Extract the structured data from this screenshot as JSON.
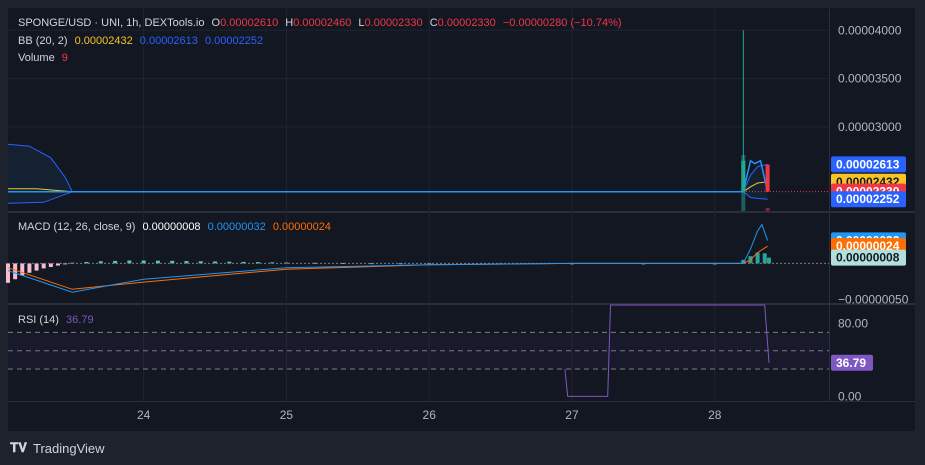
{
  "header": {
    "symbol": "SPONGE/USD · UNI, 1h, DEXTools.io",
    "o_label": "O",
    "o_value": "0.00002610",
    "h_label": "H",
    "h_value": "0.00002460",
    "l_label": "L",
    "l_value": "0.00002330",
    "c_label": "C",
    "c_value": "0.00002330",
    "change": "−0.00000280 (−10.74%)"
  },
  "bb_legend": {
    "label": "BB (20, 2)",
    "basis": "0.00002432",
    "upper": "0.00002613",
    "lower": "0.00002252"
  },
  "volume_legend": {
    "label": "Volume",
    "value": "9"
  },
  "macd_legend": {
    "label": "MACD (12, 26, close, 9)",
    "hist": "0.00000008",
    "macd": "0.00000032",
    "signal": "0.00000024"
  },
  "rsi_legend": {
    "label": "RSI (14)",
    "value": "36.79"
  },
  "price_axis": {
    "ticks": [
      "0.00004000",
      "0.00003500",
      "0.00003000"
    ],
    "tick_values": [
      4e-05,
      3.5e-05,
      3e-05
    ],
    "labels": [
      {
        "text": "0.00002613",
        "value": 2.613e-05,
        "color": "#2962ff",
        "text_color": "#ffffff"
      },
      {
        "text": "0.00002432",
        "value": 2.432e-05,
        "color": "#f7c325",
        "text_color": "#131722"
      },
      {
        "text": "0.00002330",
        "value": 2.33e-05,
        "color": "#f23645",
        "text_color": "#ffffff"
      },
      {
        "text": "0.00002252",
        "value": 2.252e-05,
        "color": "#2962ff",
        "text_color": "#ffffff"
      }
    ]
  },
  "macd_axis": {
    "labels": [
      {
        "text": "0.00000032",
        "value": 3.2e-07,
        "color": "#2196f3",
        "text_color": "#ffffff"
      },
      {
        "text": "0.00000024",
        "value": 2.4e-07,
        "color": "#ff6d00",
        "text_color": "#ffffff"
      },
      {
        "text": "0.00000008",
        "value": 8e-08,
        "color": "#b2dfdb",
        "text_color": "#131722"
      }
    ],
    "tick": "−0.00000050",
    "tick_value": -5e-07
  },
  "rsi_axis": {
    "ticks": [
      "80.00",
      "0.00"
    ],
    "tick_values": [
      80,
      0
    ],
    "label": {
      "text": "36.79",
      "value": 36.79,
      "color": "#7e57c2",
      "text_color": "#ffffff"
    }
  },
  "time_axis": {
    "labels": [
      "24",
      "25",
      "26",
      "27",
      "28"
    ],
    "positions": [
      24,
      25,
      26,
      27,
      28
    ]
  },
  "branding": {
    "name": "TradingView"
  },
  "colors": {
    "bull": "#26a69a",
    "bear": "#f23645",
    "bb_basis": "#f7c325",
    "bb_band": "#2962ff",
    "macd": "#2196f3",
    "signal": "#ff6d00",
    "rsi": "#7e57c2",
    "price_line": "#2196f3"
  },
  "chart_data": [
    {
      "type": "line",
      "title": "SPONGE/USD · UNI, 1h, DEXTools.io",
      "x_range": [
        23.05,
        28.8
      ],
      "y_range": [
        2.13e-05,
        4.22e-05
      ],
      "series": [
        {
          "name": "Close",
          "x": [
            23.05,
            23.5,
            24,
            25,
            26,
            27,
            28,
            28.2,
            28.25,
            28.28,
            28.32,
            28.37
          ],
          "y": [
            2.33e-05,
            2.33e-05,
            2.33e-05,
            2.33e-05,
            2.33e-05,
            2.33e-05,
            2.33e-05,
            2.33e-05,
            2.65e-05,
            2.62e-05,
            2.65e-05,
            2.33e-05
          ]
        },
        {
          "name": "BB basis",
          "x": [
            23.05,
            23.25,
            23.5,
            28.2,
            28.25,
            28.3,
            28.37
          ],
          "y": [
            2.36e-05,
            2.36e-05,
            2.33e-05,
            2.33e-05,
            2.38e-05,
            2.42e-05,
            2.432e-05
          ]
        },
        {
          "name": "BB upper",
          "x": [
            23.05,
            23.2,
            23.35,
            23.45,
            23.5,
            28.2,
            28.25,
            28.3,
            28.37
          ],
          "y": [
            2.82e-05,
            2.8e-05,
            2.68e-05,
            2.48e-05,
            2.33e-05,
            2.33e-05,
            2.5e-05,
            2.59e-05,
            2.613e-05
          ]
        },
        {
          "name": "BB lower",
          "x": [
            23.05,
            23.3,
            23.5,
            28.2,
            28.25,
            28.3,
            28.37
          ],
          "y": [
            2.21e-05,
            2.22e-05,
            2.33e-05,
            2.33e-05,
            2.27e-05,
            2.26e-05,
            2.252e-05
          ]
        }
      ],
      "candles": [
        {
          "x": 28.2,
          "open": 2.33e-05,
          "high": 4e-05,
          "low": 2.33e-05,
          "close": 2.65e-05
        },
        {
          "x": 28.37,
          "open": 2.61e-05,
          "high": 2.61e-05,
          "low": 2.33e-05,
          "close": 2.33e-05
        }
      ],
      "volume": {
        "x": [
          28.2,
          28.37
        ],
        "values": [
          9,
          0.5
        ]
      }
    },
    {
      "type": "bar",
      "title": "MACD (12, 26, close, 9)",
      "y_range": [
        -5.5e-07,
        7e-07
      ],
      "histogram": {
        "x": [
          23.05,
          23.1,
          23.15,
          23.2,
          23.25,
          23.3,
          23.35,
          23.4,
          23.45,
          23.5,
          23.6,
          23.7,
          23.8,
          23.9,
          24.0,
          24.1,
          24.2,
          24.3,
          24.4,
          24.5,
          24.6,
          24.7,
          24.8,
          24.9,
          25.0,
          25.2,
          25.4,
          25.6,
          25.8,
          26.0,
          26.5,
          27.0,
          27.5,
          28.0,
          28.2,
          28.25,
          28.3,
          28.35,
          28.38
        ],
        "values": [
          -2.7e-07,
          -2.2e-07,
          -1.7e-07,
          -1.3e-07,
          -1e-07,
          -7e-08,
          -5e-08,
          -3e-08,
          -1e-08,
          1e-08,
          2e-08,
          3e-08,
          3.5e-08,
          4e-08,
          4e-08,
          3.8e-08,
          3.6e-08,
          3.3e-08,
          3e-08,
          2.7e-08,
          2.4e-08,
          2.1e-08,
          1.8e-08,
          1.5e-08,
          1.2e-08,
          9e-09,
          6e-09,
          4e-09,
          3e-09,
          2e-09,
          1e-09,
          5e-10,
          3e-10,
          1e-10,
          5e-08,
          1e-07,
          1.5e-07,
          1.4e-07,
          8e-08
        ]
      },
      "series": [
        {
          "name": "MACD",
          "x": [
            23.05,
            23.5,
            24,
            25,
            26,
            27,
            28,
            28.2,
            28.25,
            28.3,
            28.33,
            28.37
          ],
          "y": [
            -1e-07,
            -4e-07,
            -2.2e-07,
            -6e-08,
            -2e-08,
            0,
            0,
            0,
            2e-07,
            4.5e-07,
            5.4e-07,
            3.2e-07
          ]
        },
        {
          "name": "Signal",
          "x": [
            23.05,
            23.5,
            24,
            25,
            26,
            27,
            28,
            28.2,
            28.25,
            28.3,
            28.37
          ],
          "y": [
            -6e-08,
            -3.6e-07,
            -2.6e-07,
            -8e-08,
            -2e-08,
            0,
            0,
            0,
            5e-08,
            1.5e-07,
            2.4e-07
          ]
        }
      ]
    },
    {
      "type": "line",
      "title": "RSI (14)",
      "y_range": [
        -5,
        100
      ],
      "bands": [
        70,
        50,
        30
      ],
      "series": [
        {
          "name": "RSI",
          "x": [
            26.95,
            26.97,
            27.25,
            27.27,
            28.35,
            28.38
          ],
          "y": [
            30,
            0,
            0,
            100,
            100,
            36.79
          ]
        }
      ]
    }
  ]
}
